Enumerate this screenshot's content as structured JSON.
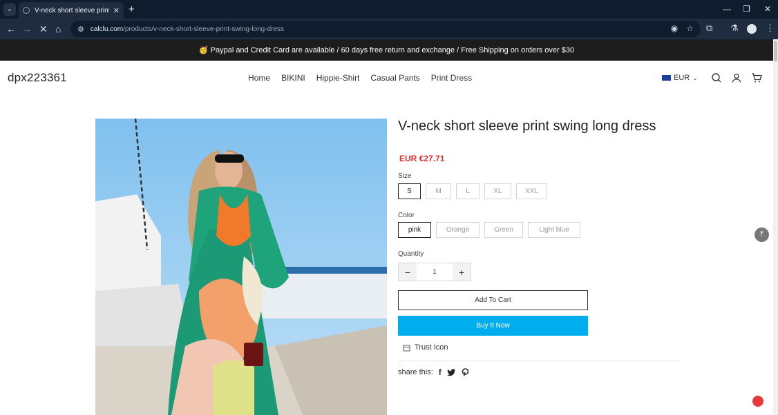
{
  "browser": {
    "tab_title": "V-neck short sleeve print swing long dress",
    "url_domain": "calclu.com",
    "url_path": "/products/v-neck-short-sleeve-print-swing-long-dress"
  },
  "announcement": "🥳 Paypal and Credit Card are available / 60 days free return and exchange / Free Shipping on orders over $30",
  "header": {
    "logo": "dpx223361",
    "nav": [
      "Home",
      "BIKINI",
      "Hippie-Shirt",
      "Casual Pants",
      "Print Dress"
    ],
    "currency": "EUR"
  },
  "product": {
    "title": "V-neck short sleeve print swing long dress",
    "price": "EUR €27.71",
    "size_label": "Size",
    "sizes": [
      "S",
      "M",
      "L",
      "XL",
      "XXL"
    ],
    "selected_size": "S",
    "color_label": "Color",
    "colors": [
      "pink",
      "Orange",
      "Green",
      "Light blue"
    ],
    "selected_color": "pink",
    "quantity_label": "Quantity",
    "quantity": "1",
    "add_to_cart": "Add To Cart",
    "buy_now": "Buy It Now",
    "trust": "Trust Icon",
    "share_label": "share this:"
  },
  "colors": {
    "announce_bg": "#1d1d1d",
    "price": "#e02d2d",
    "buy_now_bg": "#00aef0",
    "chrome_bg": "#0f1c2e"
  }
}
